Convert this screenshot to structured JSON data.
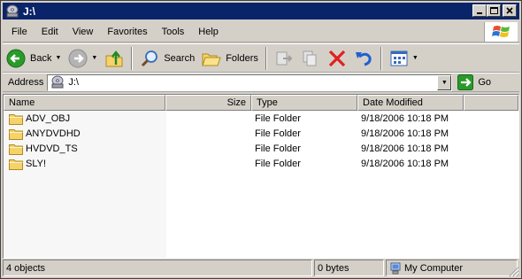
{
  "window": {
    "title": "J:\\"
  },
  "menu": [
    "File",
    "Edit",
    "View",
    "Favorites",
    "Tools",
    "Help"
  ],
  "toolbar": {
    "back_label": "Back",
    "search_label": "Search",
    "folders_label": "Folders"
  },
  "address": {
    "label": "Address",
    "value": "J:\\",
    "go_label": "Go"
  },
  "columns": {
    "name": "Name",
    "size": "Size",
    "type": "Type",
    "date": "Date Modified"
  },
  "files": [
    {
      "name": "ADV_OBJ",
      "size": "",
      "type": "File Folder",
      "date": "9/18/2006 10:18 PM"
    },
    {
      "name": "ANYDVDHD",
      "size": "",
      "type": "File Folder",
      "date": "9/18/2006 10:18 PM"
    },
    {
      "name": "HVDVD_TS",
      "size": "",
      "type": "File Folder",
      "date": "9/18/2006 10:18 PM"
    },
    {
      "name": "SLY!",
      "size": "",
      "type": "File Folder",
      "date": "9/18/2006 10:18 PM"
    }
  ],
  "status": {
    "objects": "4 objects",
    "size": "0 bytes",
    "location": "My Computer"
  },
  "icons": {
    "folder": "folder-icon",
    "drive": "dvd-drive-icon",
    "computer": "my-computer-icon"
  },
  "colors": {
    "titlebar": "#0a246a",
    "face": "#d4d0c8",
    "delete_red": "#e02020",
    "back_green": "#2a9a2a"
  }
}
